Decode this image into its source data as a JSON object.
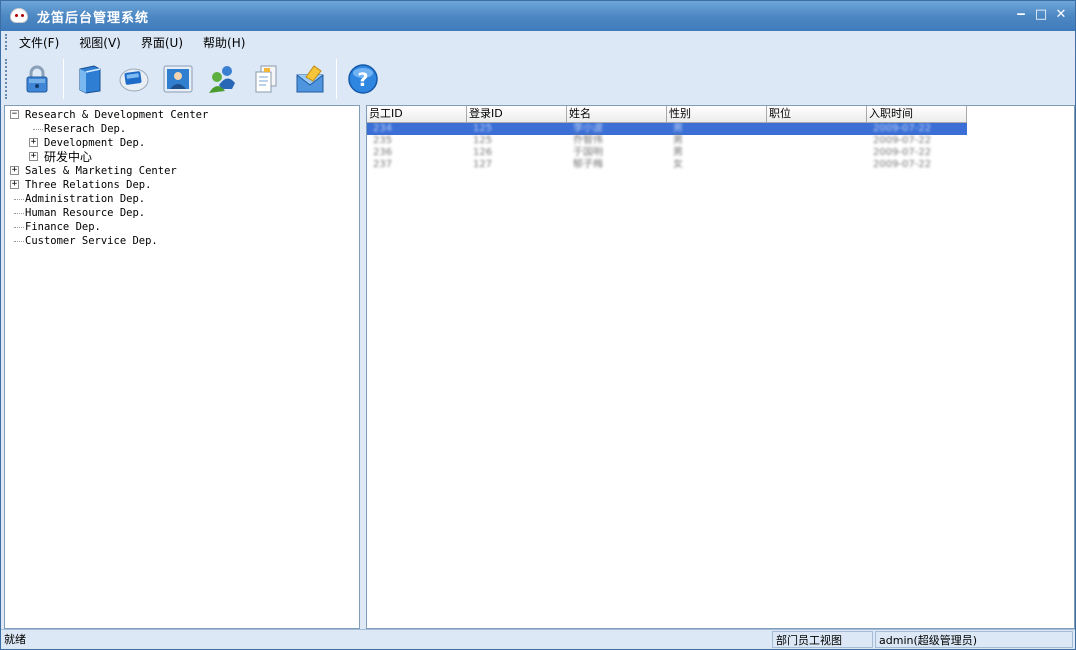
{
  "window": {
    "title": "龙笛后台管理系统"
  },
  "menu": [
    {
      "label": "文件(F)"
    },
    {
      "label": "视图(V)"
    },
    {
      "label": "界面(U)"
    },
    {
      "label": "帮助(H)"
    }
  ],
  "toolbar": {
    "buttons": [
      {
        "icon": "lock-icon"
      },
      {
        "icon": "book-icon"
      },
      {
        "icon": "monitor-icon"
      },
      {
        "icon": "user-card-icon"
      },
      {
        "icon": "users-icon"
      },
      {
        "icon": "documents-icon"
      },
      {
        "icon": "mail-icon"
      },
      {
        "icon": "help-icon"
      }
    ]
  },
  "tree": {
    "nodes": [
      {
        "label": "Research & Development Center",
        "level": 0,
        "expander": "minus"
      },
      {
        "label": "Reserach Dep.",
        "level": 1,
        "expander": "none"
      },
      {
        "label": "Development Dep.",
        "level": 1,
        "expander": "plus"
      },
      {
        "label": "研发中心",
        "level": 1,
        "expander": "plus"
      },
      {
        "label": "Sales & Marketing Center",
        "level": 0,
        "expander": "plus"
      },
      {
        "label": "Three Relations Dep.",
        "level": 0,
        "expander": "plus"
      },
      {
        "label": "Administration Dep.",
        "level": 0,
        "expander": "none"
      },
      {
        "label": "Human Resource Dep.",
        "level": 0,
        "expander": "none"
      },
      {
        "label": "Finance Dep.",
        "level": 0,
        "expander": "none"
      },
      {
        "label": "Customer Service Dep.",
        "level": 0,
        "expander": "none"
      }
    ]
  },
  "grid": {
    "columns": [
      "员工ID",
      "登录ID",
      "姓名",
      "性别",
      "职位",
      "入职时间"
    ],
    "rows": [
      [
        "234",
        "125",
        "李小波",
        "男",
        "",
        "2009-07-22"
      ],
      [
        "235",
        "125",
        "乔智伟",
        "男",
        "",
        "2009-07-22"
      ],
      [
        "236",
        "126",
        "于国明",
        "男",
        "",
        "2009-07-22"
      ],
      [
        "237",
        "127",
        "郁子梅",
        "女",
        "",
        "2009-07-22"
      ]
    ],
    "selected_row": 0
  },
  "status": {
    "left": "就绪",
    "view": "部门员工视图",
    "user": "admin(超级管理员)"
  }
}
